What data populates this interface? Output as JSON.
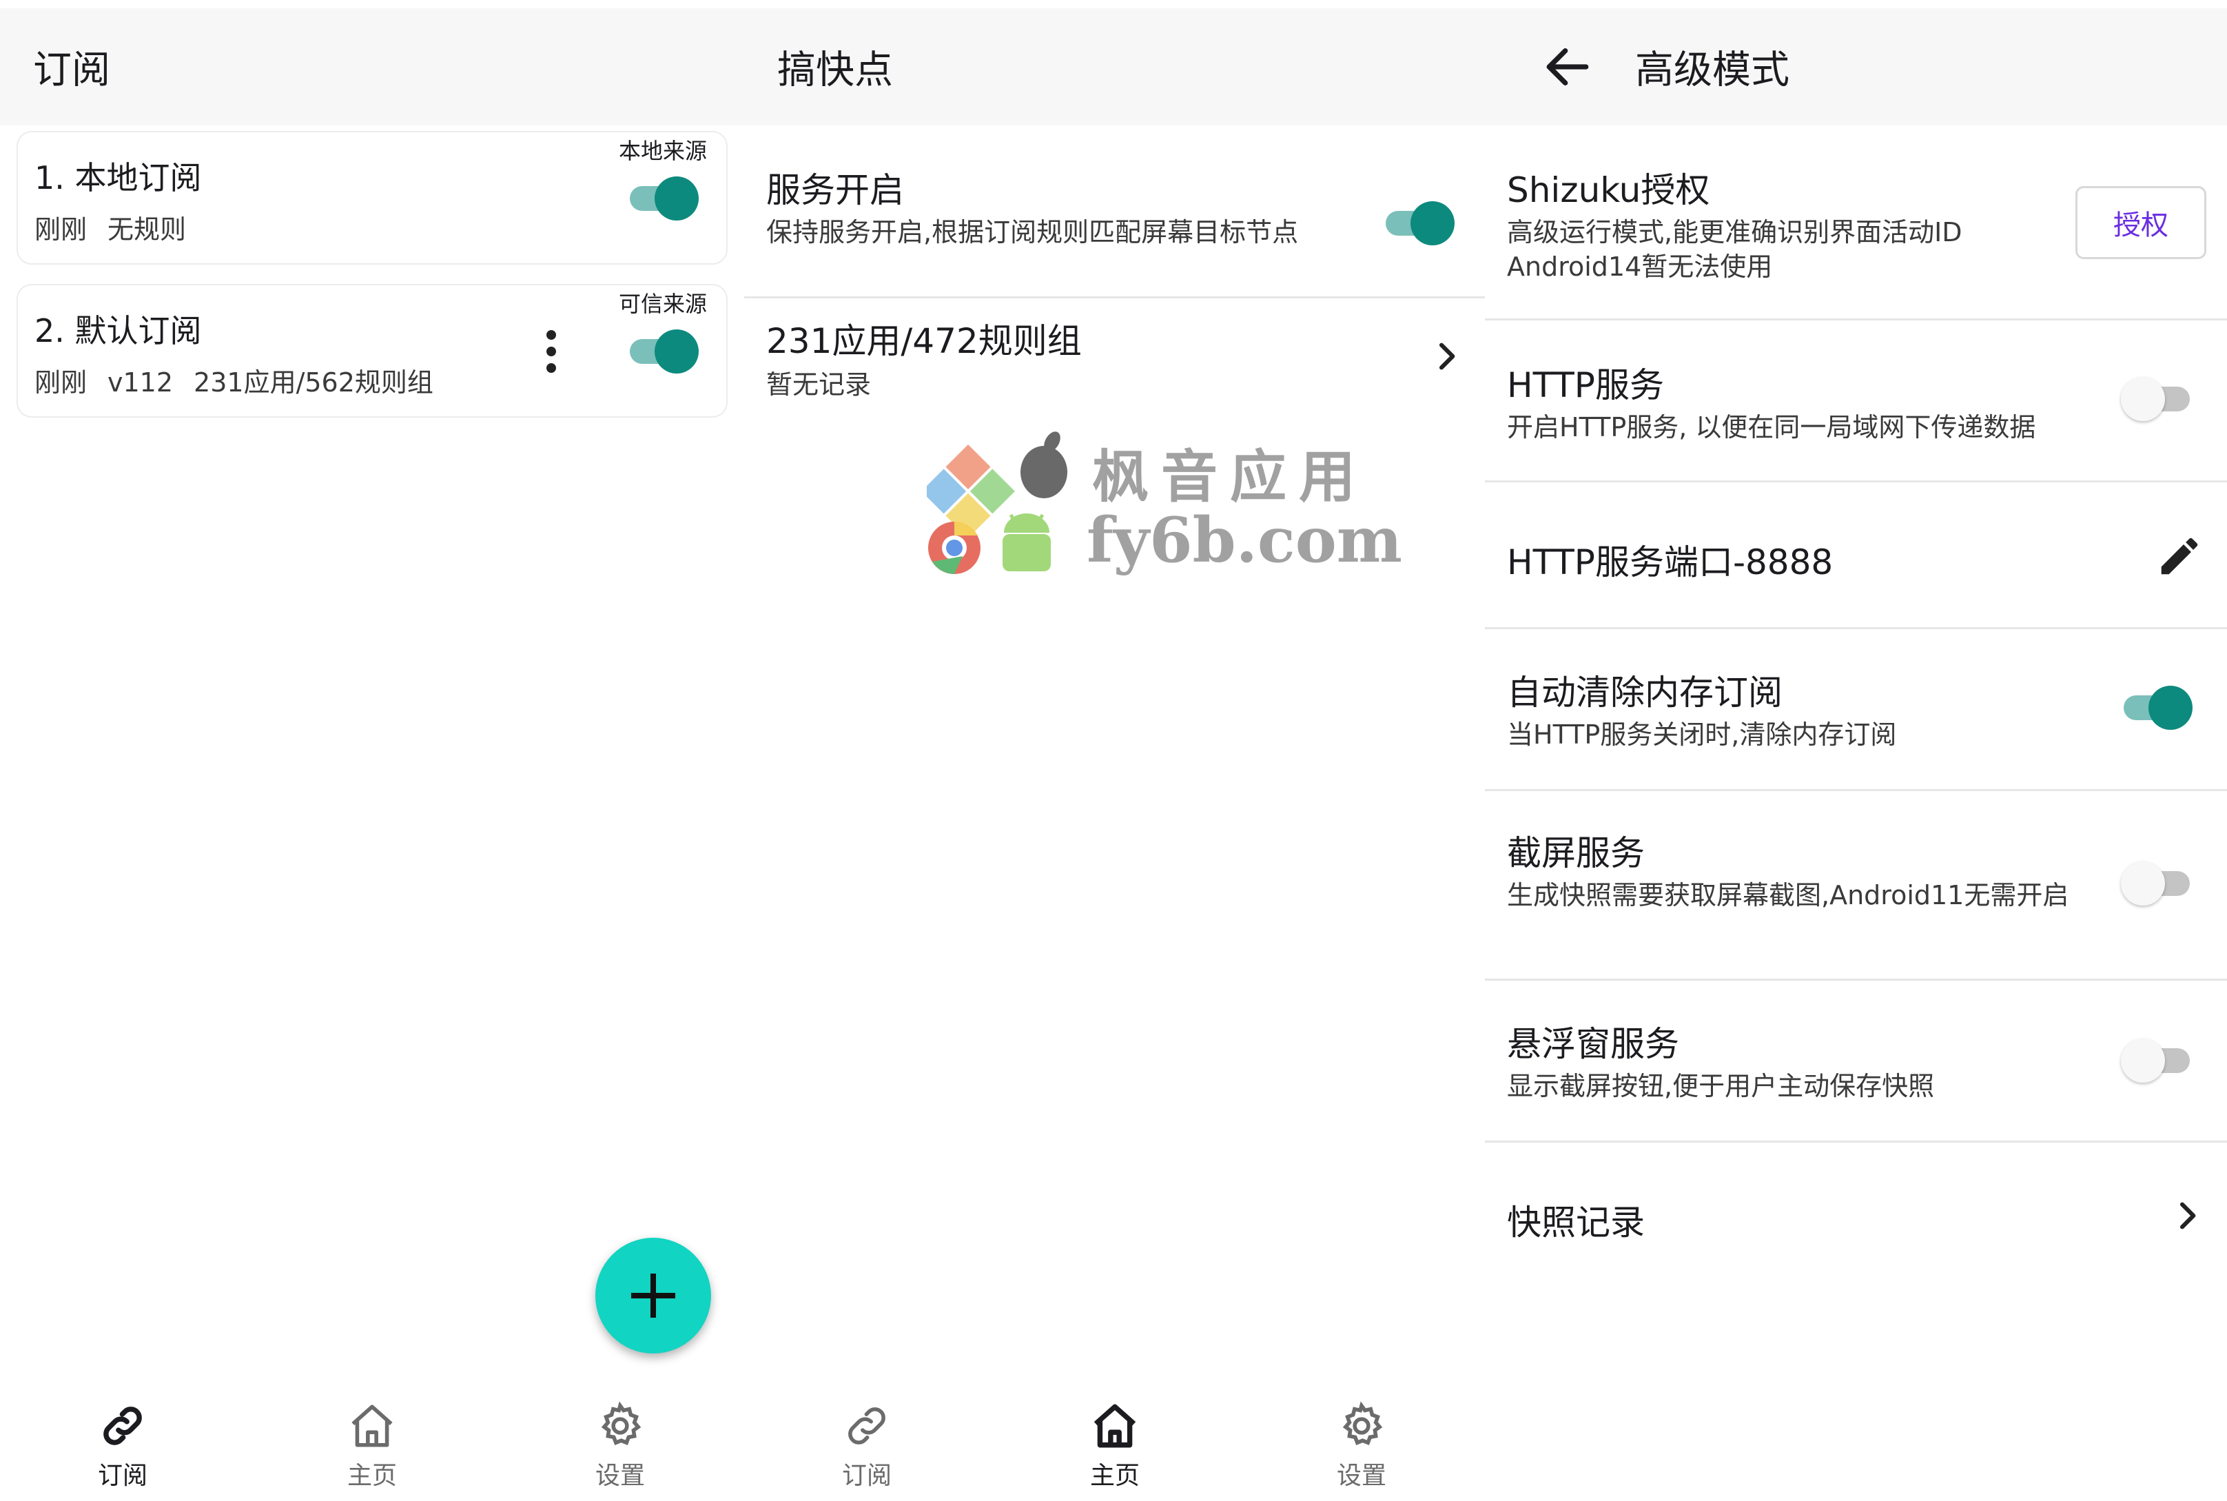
{
  "subscription_screen": {
    "title": "订阅",
    "cards": [
      {
        "title": "1. 本地订阅",
        "source": "本地来源",
        "meta": [
          "刚刚",
          "无规则"
        ],
        "enabled": true,
        "has_menu": false
      },
      {
        "title": "2. 默认订阅",
        "source": "可信来源",
        "meta": [
          "刚刚",
          "v112",
          "231应用/562规则组"
        ],
        "enabled": true,
        "has_menu": true
      }
    ],
    "fab_icon": "plus-icon",
    "nav": [
      {
        "label": "订阅",
        "icon": "link-icon",
        "active": true
      },
      {
        "label": "主页",
        "icon": "home-icon",
        "active": false
      },
      {
        "label": "设置",
        "icon": "gear-icon",
        "active": false
      }
    ]
  },
  "home_screen": {
    "title": "搞快点",
    "service": {
      "title": "服务开启",
      "desc": "保持服务开启,根据订阅规则匹配屏幕目标节点",
      "enabled": true
    },
    "stats": {
      "title": "231应用/472规则组",
      "desc": "暂无记录"
    },
    "nav": [
      {
        "label": "订阅",
        "icon": "link-icon",
        "active": false
      },
      {
        "label": "主页",
        "icon": "home-icon",
        "active": true
      },
      {
        "label": "设置",
        "icon": "gear-icon",
        "active": false
      }
    ]
  },
  "advanced_screen": {
    "title": "高级模式",
    "shizuku": {
      "title": "Shizuku授权",
      "desc": "高级运行模式,能更准确识别界面活动ID\nAndroid14暂无法使用",
      "button": "授权"
    },
    "http_service": {
      "title": "HTTP服务",
      "desc": "开启HTTP服务, 以便在同一局域网下传递数据",
      "enabled": false
    },
    "http_port": {
      "title": "HTTP服务端口-8888"
    },
    "auto_clear": {
      "title": "自动清除内存订阅",
      "desc": "当HTTP服务关闭时,清除内存订阅",
      "enabled": true
    },
    "screenshot": {
      "title": "截屏服务",
      "desc": "生成快照需要获取屏幕截图,Android11无需开启",
      "enabled": false
    },
    "float_window": {
      "title": "悬浮窗服务",
      "desc": "显示截屏按钮,便于用户主动保存快照",
      "enabled": false
    },
    "snapshot": {
      "title": "快照记录"
    }
  },
  "watermark": {
    "line1": "枫音应用",
    "line2": "fy6b.com"
  },
  "colors": {
    "switch_on_thumb": "#0d8a7e",
    "switch_on_track": "#7bbfba",
    "fab": "#12d4c2",
    "auth_button_text": "#6a2de0"
  }
}
